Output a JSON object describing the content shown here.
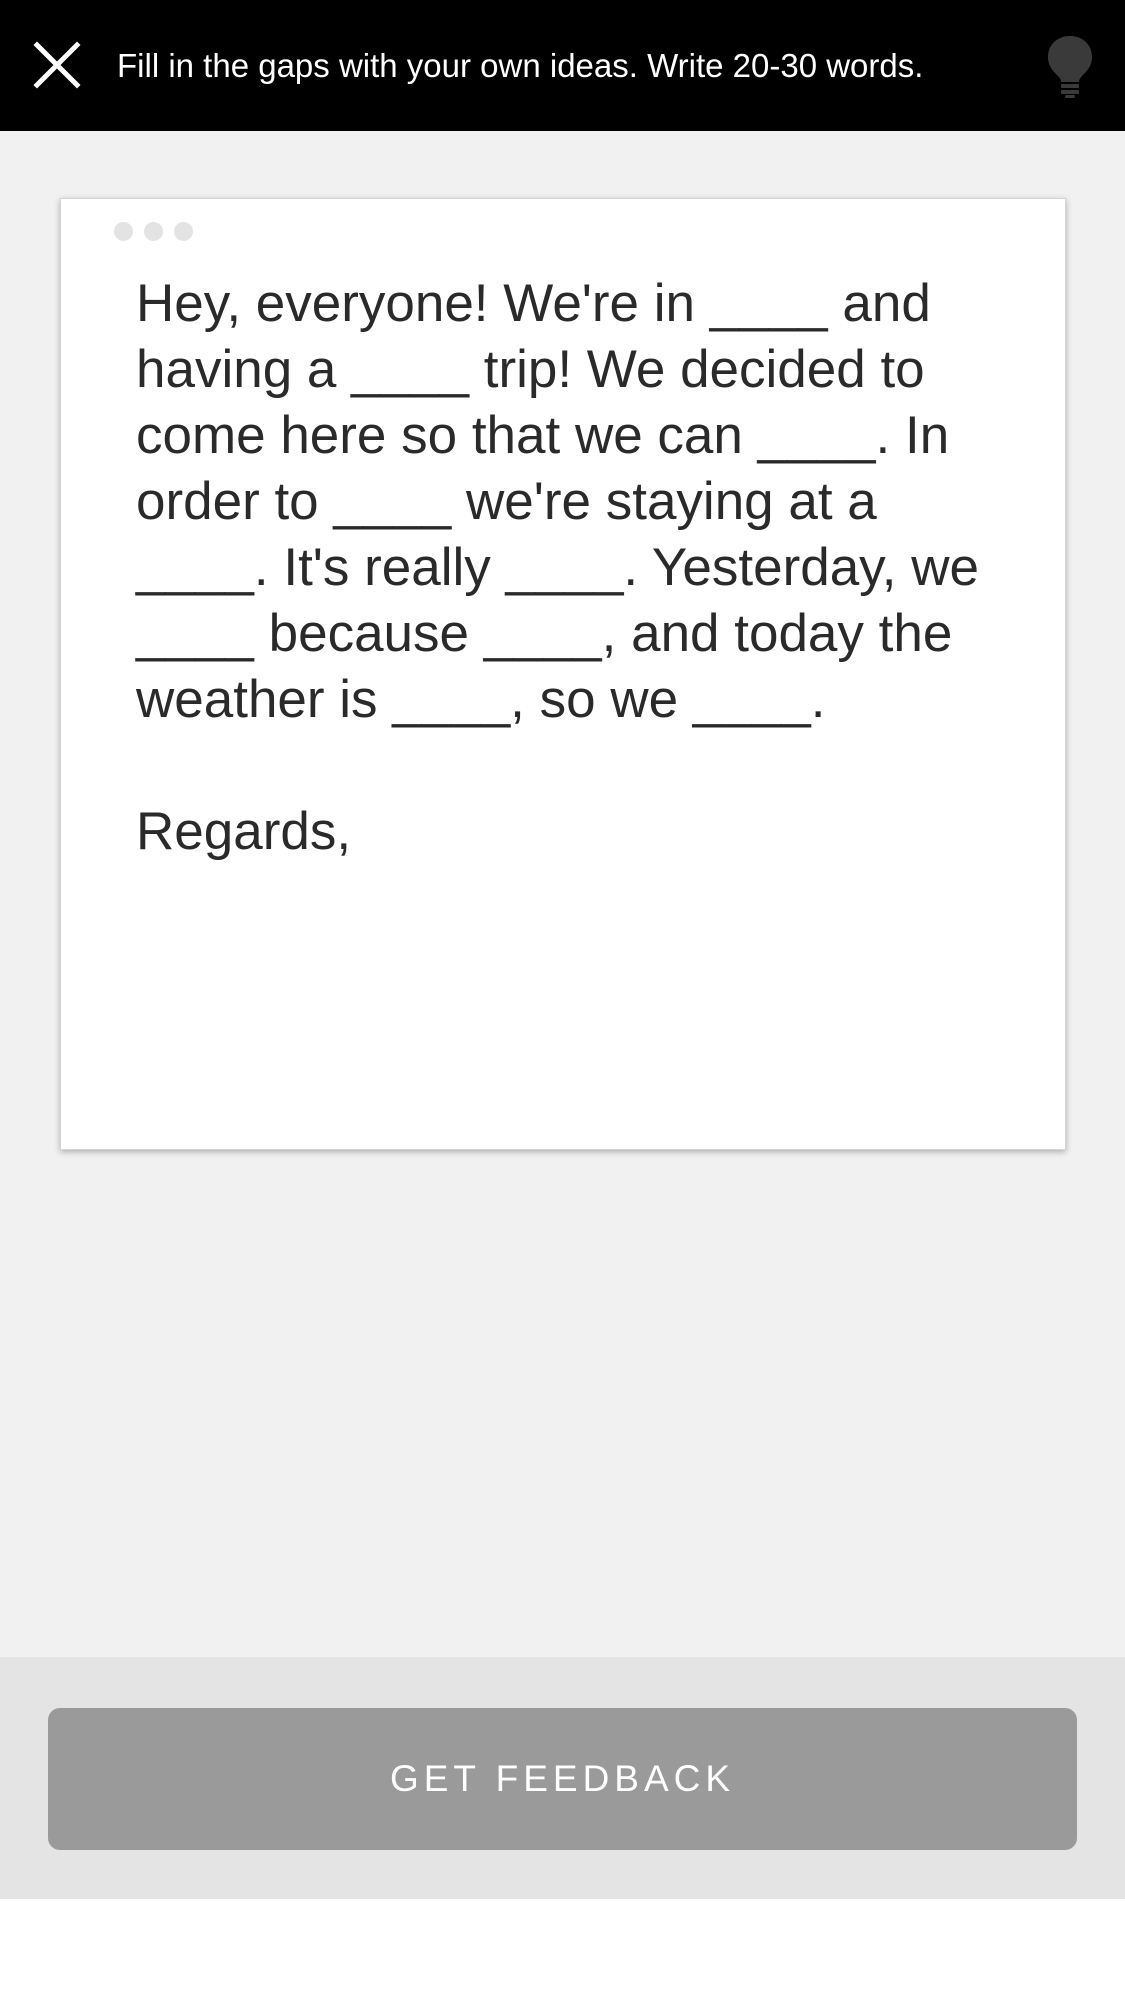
{
  "header": {
    "instruction": "Fill in the gaps with your own ideas. Write 20-30 words.",
    "close_icon": "close-icon",
    "hint_icon": "lightbulb-icon"
  },
  "editor": {
    "menu_icon": "more-dots-icon",
    "text": "Hey, everyone! We're in ____ and\nhaving a ____ trip! We decided to\ncome here so that we can ____. In\norder to ____ we're staying at a\n____. It's really ____. Yesterday, we\n____ because ____, and today the\nweather is ____, so we ____.\n\nRegards,"
  },
  "footer": {
    "button_label": "GET FEEDBACK"
  },
  "colors": {
    "topbar": "#000000",
    "background": "#f1f1f1",
    "button": "#9a9a9a",
    "footer": "#e4e4e4"
  }
}
